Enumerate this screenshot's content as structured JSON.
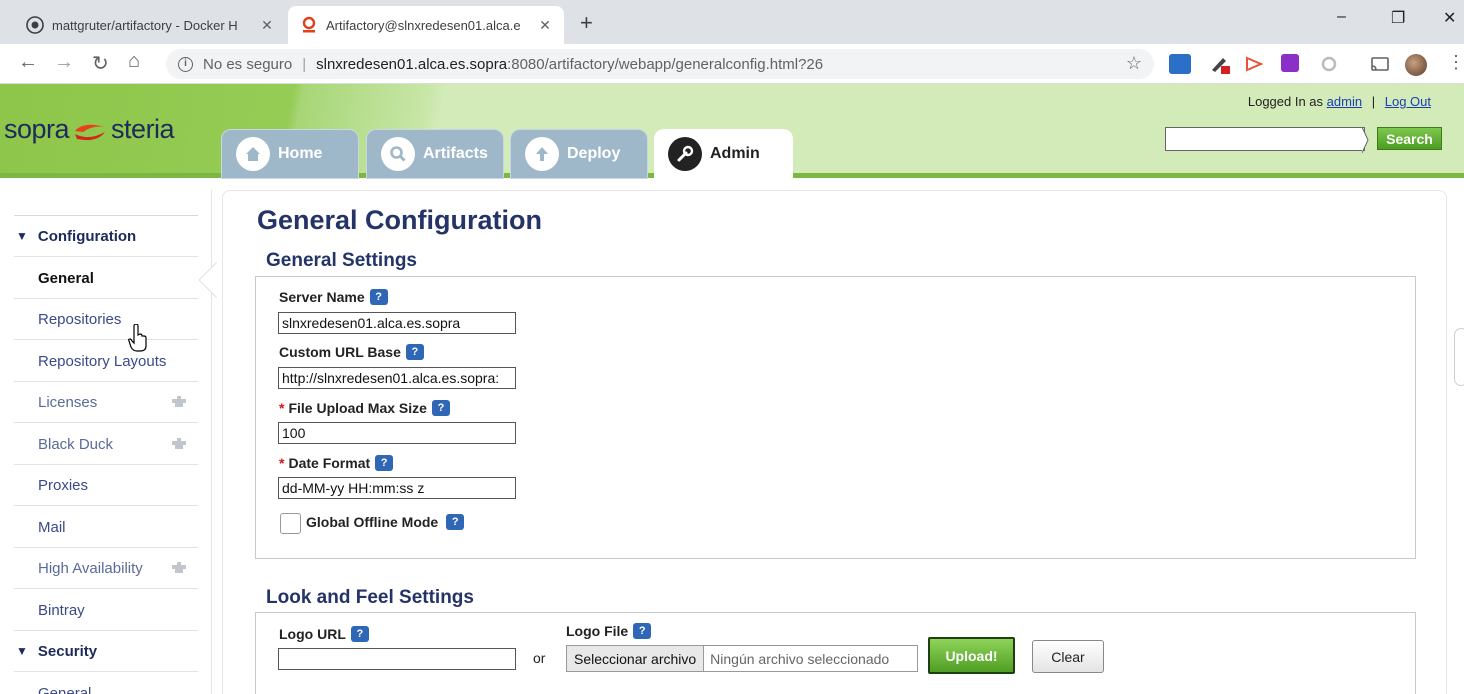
{
  "browser": {
    "tabs": [
      {
        "title": "mattgruter/artifactory - Docker H",
        "active": false
      },
      {
        "title": "Artifactory@slnxredesen01.alca.e",
        "active": true
      }
    ],
    "new_tab": "+",
    "window_controls": {
      "minimize": "–",
      "restore": "❐",
      "close": "✕"
    },
    "security_label": "No es seguro",
    "url_host": "slnxredesen01.alca.es.sopra",
    "url_rest": ":8080/artifactory/webapp/generalconfig.html?26"
  },
  "header": {
    "logo_left": "sopra",
    "logo_right": "steria",
    "tabs": [
      {
        "label": "Home",
        "icon": "home-icon",
        "active": false
      },
      {
        "label": "Artifacts",
        "icon": "search-icon",
        "active": false
      },
      {
        "label": "Deploy",
        "icon": "upload-icon",
        "active": false
      },
      {
        "label": "Admin",
        "icon": "wrench-icon",
        "active": true
      }
    ],
    "logged_in_prefix": "Logged In as",
    "user": "admin",
    "separator": "|",
    "logout": "Log Out",
    "search_value": "",
    "search_button": "Search"
  },
  "sidebar": {
    "items": [
      {
        "label": "Configuration",
        "type": "section"
      },
      {
        "label": "General",
        "type": "selected"
      },
      {
        "label": "Repositories",
        "type": "item"
      },
      {
        "label": "Repository Layouts",
        "type": "item"
      },
      {
        "label": "Licenses",
        "type": "plugin"
      },
      {
        "label": "Black Duck",
        "type": "plugin"
      },
      {
        "label": "Proxies",
        "type": "item"
      },
      {
        "label": "Mail",
        "type": "item"
      },
      {
        "label": "High Availability",
        "type": "plugin"
      },
      {
        "label": "Bintray",
        "type": "item"
      },
      {
        "label": "Security",
        "type": "section"
      },
      {
        "label": "General",
        "type": "item"
      }
    ]
  },
  "main": {
    "title": "General Configuration",
    "general_settings": {
      "heading": "General Settings",
      "server_name_label": "Server Name",
      "server_name_value": "slnxredesen01.alca.es.sopra",
      "custom_url_label": "Custom URL Base",
      "custom_url_value": "http://slnxredesen01.alca.es.sopra:",
      "upload_max_label": "File Upload Max Size",
      "upload_max_value": "100",
      "date_format_label": "Date Format",
      "date_format_value": "dd-MM-yy HH:mm:ss z",
      "offline_label": "Global Offline Mode",
      "offline_checked": false,
      "required_mark": "*",
      "help_glyph": "?"
    },
    "look_feel": {
      "heading": "Look and Feel Settings",
      "logo_url_label": "Logo URL",
      "logo_url_value": "",
      "or_text": "or",
      "logo_file_label": "Logo File",
      "choose_file": "Seleccionar archivo",
      "no_file": "Ningún archivo seleccionado",
      "upload_button": "Upload!",
      "clear_button": "Clear"
    }
  },
  "colors": {
    "header_green": "#8dc64a",
    "title_blue": "#243368",
    "link_blue": "#1a3fb5",
    "upload_green": "#4f9e24",
    "help_blue": "#2f67b6"
  }
}
